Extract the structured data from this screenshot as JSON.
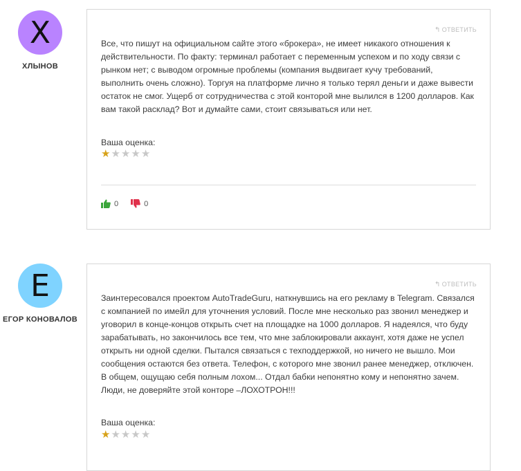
{
  "comments": [
    {
      "avatar_letter": "X",
      "avatar_color": "#b983ff",
      "author": "ХЛЫНОВ",
      "reply_label": "ОТВЕТИТЬ",
      "text": "Все, что пишут на официальном сайте этого «брокера», не имеет никакого отношения к действительности. По факту: терминал работает с переменным успехом и по ходу связи с рынком нет; с выводом огромные проблемы (компания выдвигает кучу требований, выполнить очень сложно). Торгуя на платформе лично я только терял деньги и даже вывести остаток не смог. Ущерб от сотрудничества с этой конторой мне вылился в 1200 долларов. Как вам такой расклад? Вот и думайте сами, стоит связываться или нет.",
      "rating_label": "Ваша оценка:",
      "rating": 1,
      "rating_max": 5,
      "likes": "0",
      "dislikes": "0"
    },
    {
      "avatar_letter": "E",
      "avatar_color": "#7fd3ff",
      "author": "ЕГОР КОНОВАЛОВ",
      "reply_label": "ОТВЕТИТЬ",
      "text": "Заинтересовался проектом AutoTradeGuru, наткнувшись на его рекламу в Telegram. Связался с компанией по имейл для уточнения условий. После мне несколько раз звонил менеджер и уговорил в конце-концов открыть счет на площадке на 1000 долларов. Я надеялся, что буду зарабатывать, но закончилось все тем, что мне заблокировали аккаунт, хотя даже не успел открыть ни одной сделки. Пытался связаться с техподдержкой, но ничего не вышло. Мои сообщения остаются без ответа. Телефон, с которого мне звонил ранее менеджер, отключен. В общем, ощущаю себя полным лохом... Отдал бабки непонятно кому и непонятно зачем. Люди, не доверяйте этой конторе –ЛОХОТРОН!!!",
      "rating_label": "Ваша оценка:",
      "rating": 1,
      "rating_max": 5
    }
  ],
  "colors": {
    "like": "#3aa63a",
    "dislike": "#e0314b",
    "star_filled": "#d7a21a"
  }
}
